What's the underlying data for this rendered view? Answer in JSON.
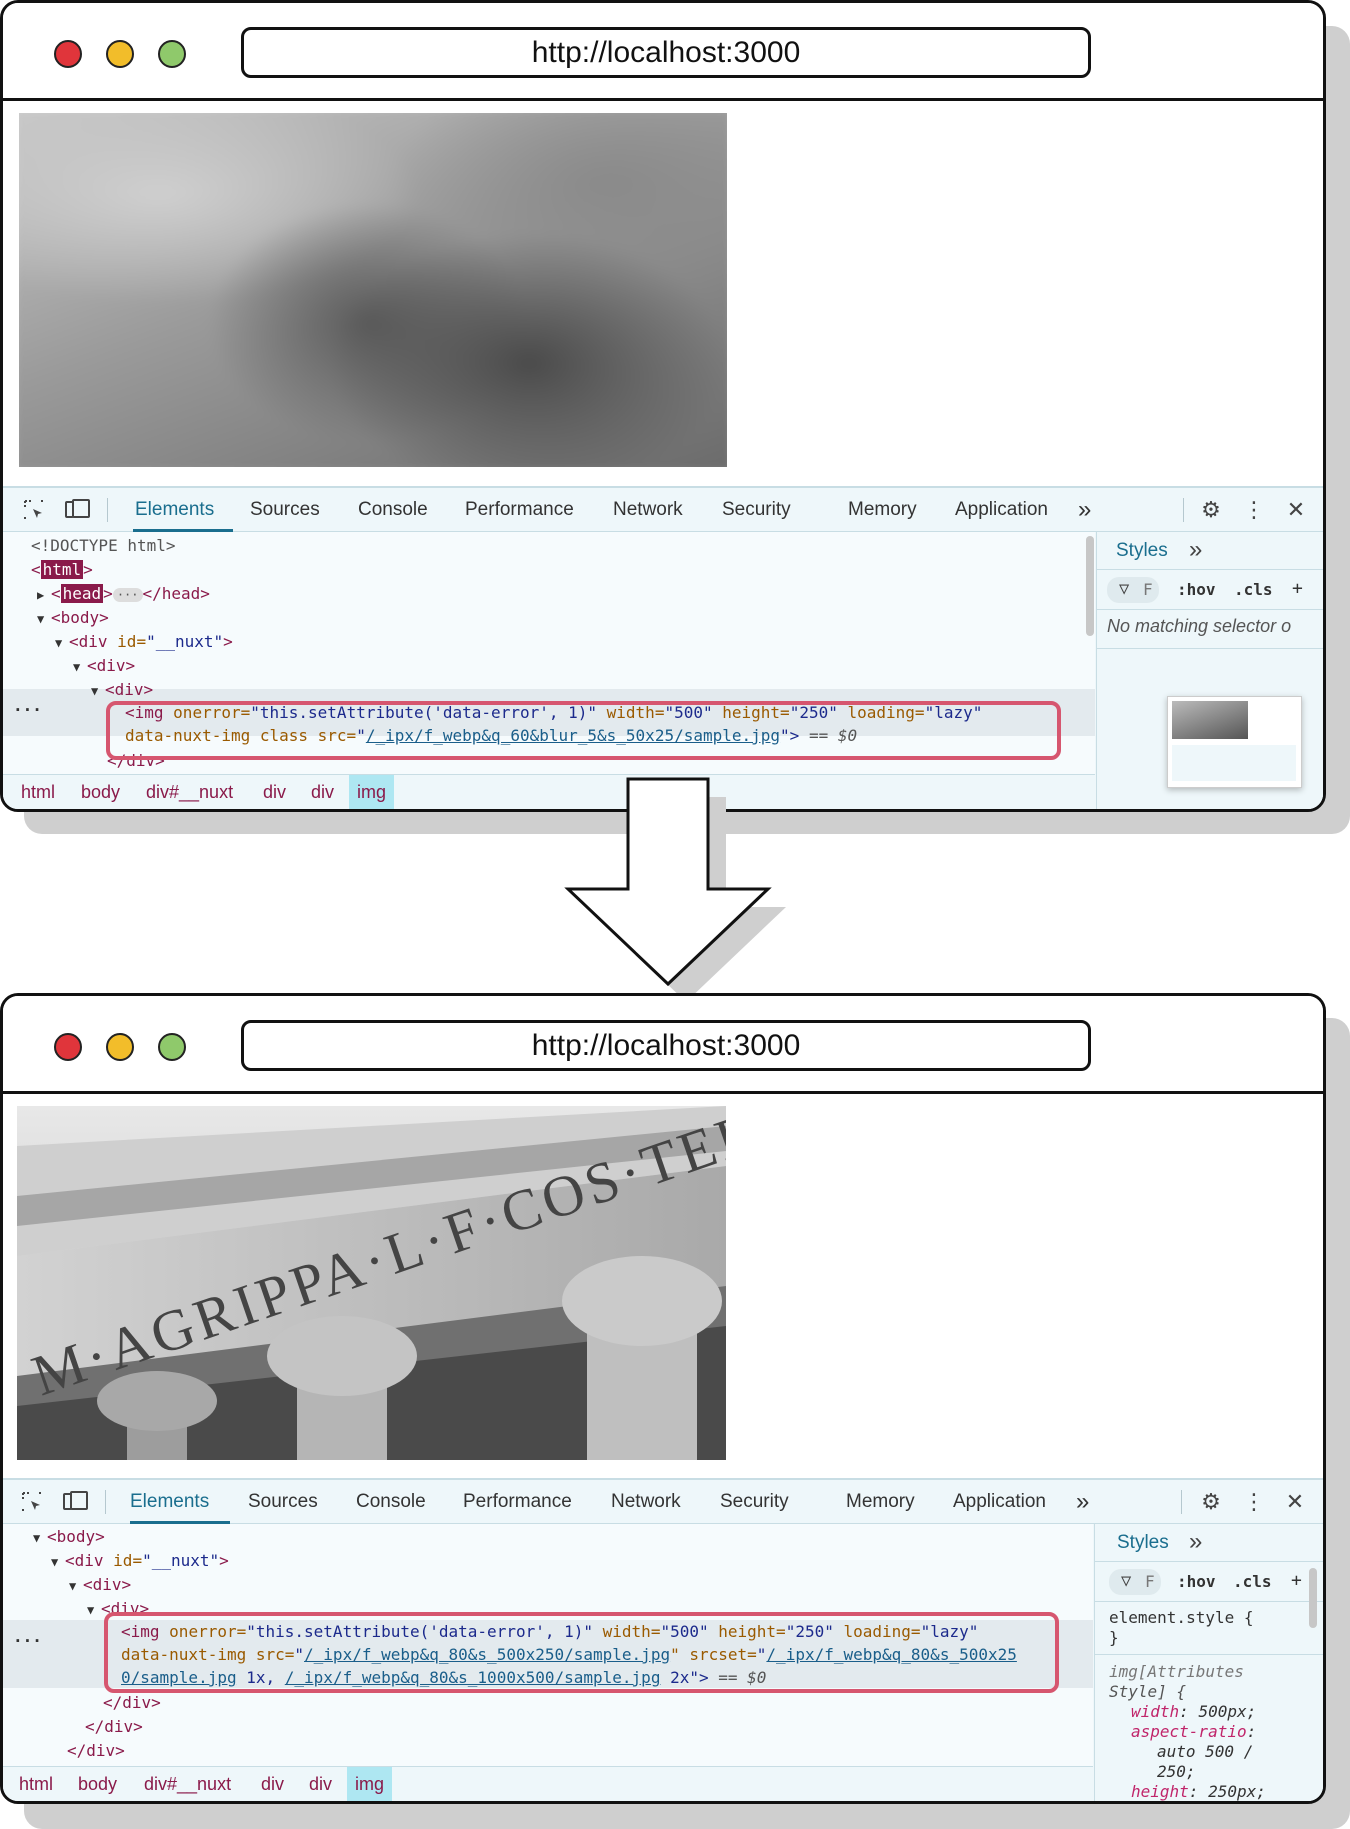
{
  "top": {
    "url": "http://localhost:3000",
    "tabs": [
      "Elements",
      "Sources",
      "Console",
      "Performance",
      "Network",
      "Security",
      "Memory",
      "Application"
    ],
    "more": "»",
    "dom": {
      "doctype": "<!DOCTYPE html>",
      "html": "html",
      "head_open": "head",
      "head_close": "</head>",
      "body": "<body>",
      "div_nuxt_open": "<div ",
      "div_nuxt_attr": "id=",
      "div_nuxt_val": "\"__nuxt\"",
      "div_nuxt_close": ">",
      "div1": "<div>",
      "div2": "<div>",
      "img_line1_a": "<img ",
      "img_line1_b": "onerror=",
      "img_line1_c": "\"this.setAttribute('data-error', 1)\"",
      "img_line1_d": " width=",
      "img_line1_e": "\"500\"",
      "img_line1_f": " height=",
      "img_line1_g": "\"250\"",
      "img_line1_h": " loading=",
      "img_line1_i": "\"lazy\"",
      "img_line2_a": "data-nuxt-img class src=",
      "img_line2_b": "\"",
      "img_line2_c": "/_ipx/f_webp&q_60&blur_5&s_50x25/sample.jpg",
      "img_line2_d": "\">",
      "img_line2_e": " == $0",
      "div_close": "</div>"
    },
    "crumbs": [
      "html",
      "body",
      "div#__nuxt",
      "div",
      "div",
      "img"
    ],
    "styles": {
      "tab": "Styles",
      "more": "»",
      "filter_label": "F",
      "hov": ":hov",
      "cls": ".cls",
      "plus": "+",
      "empty": "No matching selector o"
    }
  },
  "bottom": {
    "url": "http://localhost:3000",
    "tabs": [
      "Elements",
      "Sources",
      "Console",
      "Performance",
      "Network",
      "Security",
      "Memory",
      "Application"
    ],
    "more": "»",
    "dom": {
      "body": "<body>",
      "div_nuxt_open": "<div ",
      "div_nuxt_attr": "id=",
      "div_nuxt_val": "\"__nuxt\"",
      "div_nuxt_close": ">",
      "div1": "<div>",
      "div2": "<div>",
      "img_line1_a": "<img ",
      "img_line1_b": "onerror=",
      "img_line1_c": "\"this.setAttribute('data-error', 1)\"",
      "img_line1_d": " width=",
      "img_line1_e": "\"500\"",
      "img_line1_f": " height=",
      "img_line1_g": "\"250\"",
      "img_line1_h": " loading=",
      "img_line1_i": "\"lazy\"",
      "img_line2_a": "data-nuxt-img src=",
      "img_line2_b": "\"",
      "img_line2_c": "/_ipx/f_webp&q_80&s_500x250/sample.jpg",
      "img_line2_d": "\" srcset=",
      "img_line2_e": "\"",
      "img_line2_f": "/_ipx/f_webp&q_80&s_500x25",
      "img_line3_a": "0/sample.jpg",
      "img_line3_b": " 1x, ",
      "img_line3_c": "/_ipx/f_webp&q_80&s_1000x500/sample.jpg",
      "img_line3_d": " 2x\">",
      "img_line3_e": " == $0",
      "div_close_a": "</div>",
      "div_close_b": "</div>",
      "div_close_c": "</div>"
    },
    "crumbs": [
      "html",
      "body",
      "div#__nuxt",
      "div",
      "div",
      "img"
    ],
    "styles": {
      "tab": "Styles",
      "more": "»",
      "filter_label": "F",
      "hov": ":hov",
      "cls": ".cls",
      "plus": "+",
      "element_style": "element.style {",
      "close_brace": "}",
      "rule_selector_a": "img[Attributes",
      "rule_selector_b": "Style] {",
      "prop1_name": "width",
      "prop1_val": " 500px;",
      "prop2_name": "aspect-ratio",
      "prop2_val_a": "auto 500 /",
      "prop2_val_b": "250;",
      "prop3_name": "height",
      "prop3_val": " 250px;"
    },
    "image_text": "M·AGRIPPA·L·F·COS·TERTI"
  }
}
